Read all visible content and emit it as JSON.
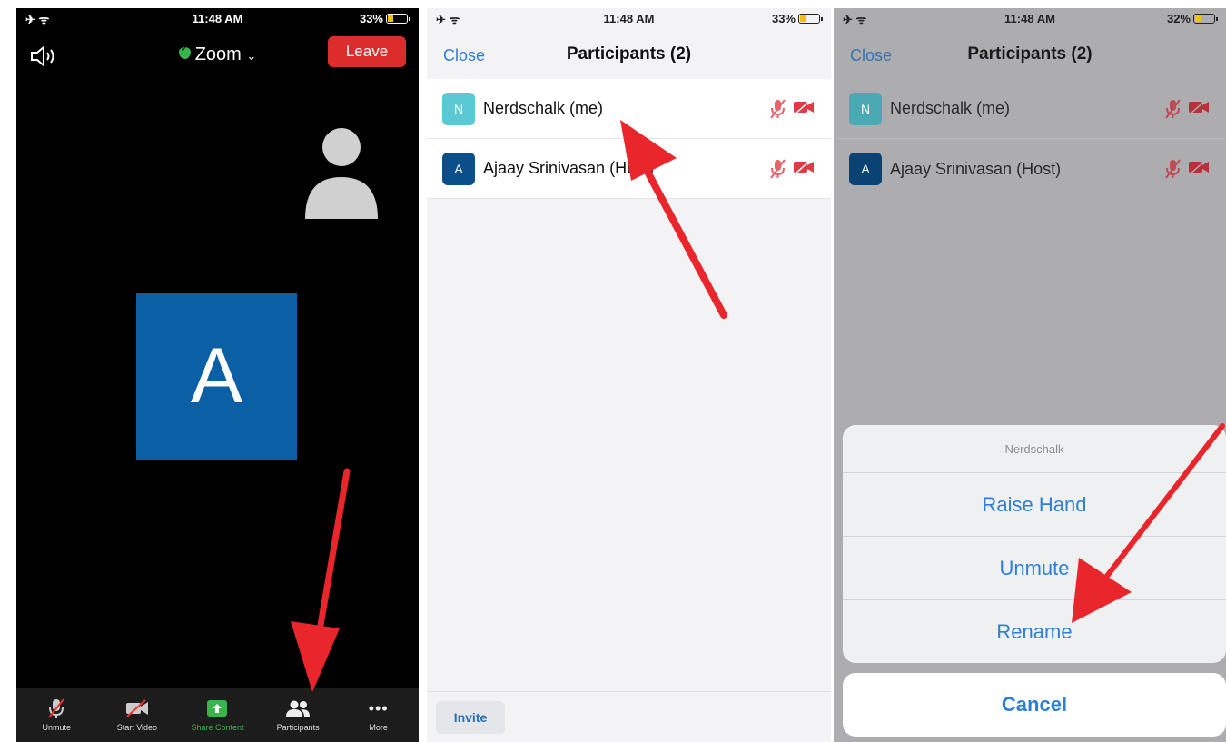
{
  "screen1": {
    "status": {
      "time": "11:48 AM",
      "battery": "33%",
      "battery_level": 0.33
    },
    "title": "Zoom",
    "leave_label": "Leave",
    "avatar_letter": "A",
    "toolbar": [
      {
        "label": "Unmute",
        "icon": "mic-muted-icon"
      },
      {
        "label": "Start Video",
        "icon": "video-off-icon"
      },
      {
        "label": "Share Content",
        "icon": "share-screen-icon"
      },
      {
        "label": "Participants",
        "icon": "participants-icon"
      },
      {
        "label": "More",
        "icon": "more-icon"
      }
    ]
  },
  "screen2": {
    "status": {
      "time": "11:48 AM",
      "battery": "33%",
      "battery_level": 0.33
    },
    "close_label": "Close",
    "title": "Participants (2)",
    "participants": [
      {
        "initial": "N",
        "name": "Nerdschalk (me)",
        "color": "#5bc9d4"
      },
      {
        "initial": "A",
        "name": "Ajaay Srinivasan (Host)",
        "color": "#0b4f8a"
      }
    ],
    "invite_label": "Invite"
  },
  "screen3": {
    "status": {
      "time": "11:48 AM",
      "battery": "32%",
      "battery_level": 0.32
    },
    "close_label": "Close",
    "title": "Participants (2)",
    "participants": [
      {
        "initial": "N",
        "name": "Nerdschalk (me)",
        "color": "#4aa9b2"
      },
      {
        "initial": "A",
        "name": "Ajaay Srinivasan (Host)",
        "color": "#0a4273"
      }
    ],
    "sheet": {
      "title": "Nerdschalk",
      "actions": [
        "Raise Hand",
        "Unmute",
        "Rename"
      ],
      "cancel_label": "Cancel"
    }
  },
  "colors": {
    "leave": "#dd2c2c",
    "link": "#2d7fd6",
    "arrow": "#e8262b",
    "green": "#3ab34a"
  }
}
